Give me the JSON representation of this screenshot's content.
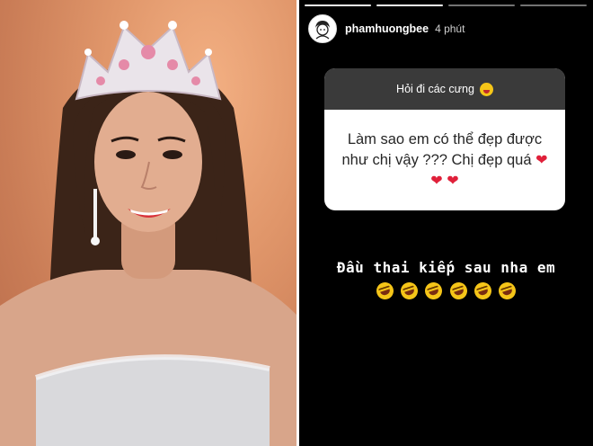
{
  "story": {
    "username": "phamhuongbee",
    "time_ago": "4 phút",
    "segments_total": 4,
    "segment_current": 2,
    "question_prompt": "Hỏi đi các cưng",
    "question_text": "Làm sao em có thể đẹp được như chị vậy ??? Chị đẹp quá",
    "hearts": [
      "❤",
      "❤",
      "❤"
    ],
    "answer_text": "Đầu thai kiếp sau nha em",
    "answer_emoji": [
      "rolling-laughing-emoji",
      "rolling-laughing-emoji",
      "rolling-laughing-emoji",
      "rolling-laughing-emoji",
      "rolling-laughing-emoji",
      "rolling-laughing-emoji"
    ]
  },
  "icons": {
    "prompt_emoji": "zany-face-icon",
    "heart_color": "#e0203a",
    "emoji_color": "#f5c518"
  },
  "colors": {
    "story_background": "#000000",
    "prompt_bar": "#3a3a3a",
    "card_background": "#ffffff",
    "photo_background": "#d9895f"
  }
}
